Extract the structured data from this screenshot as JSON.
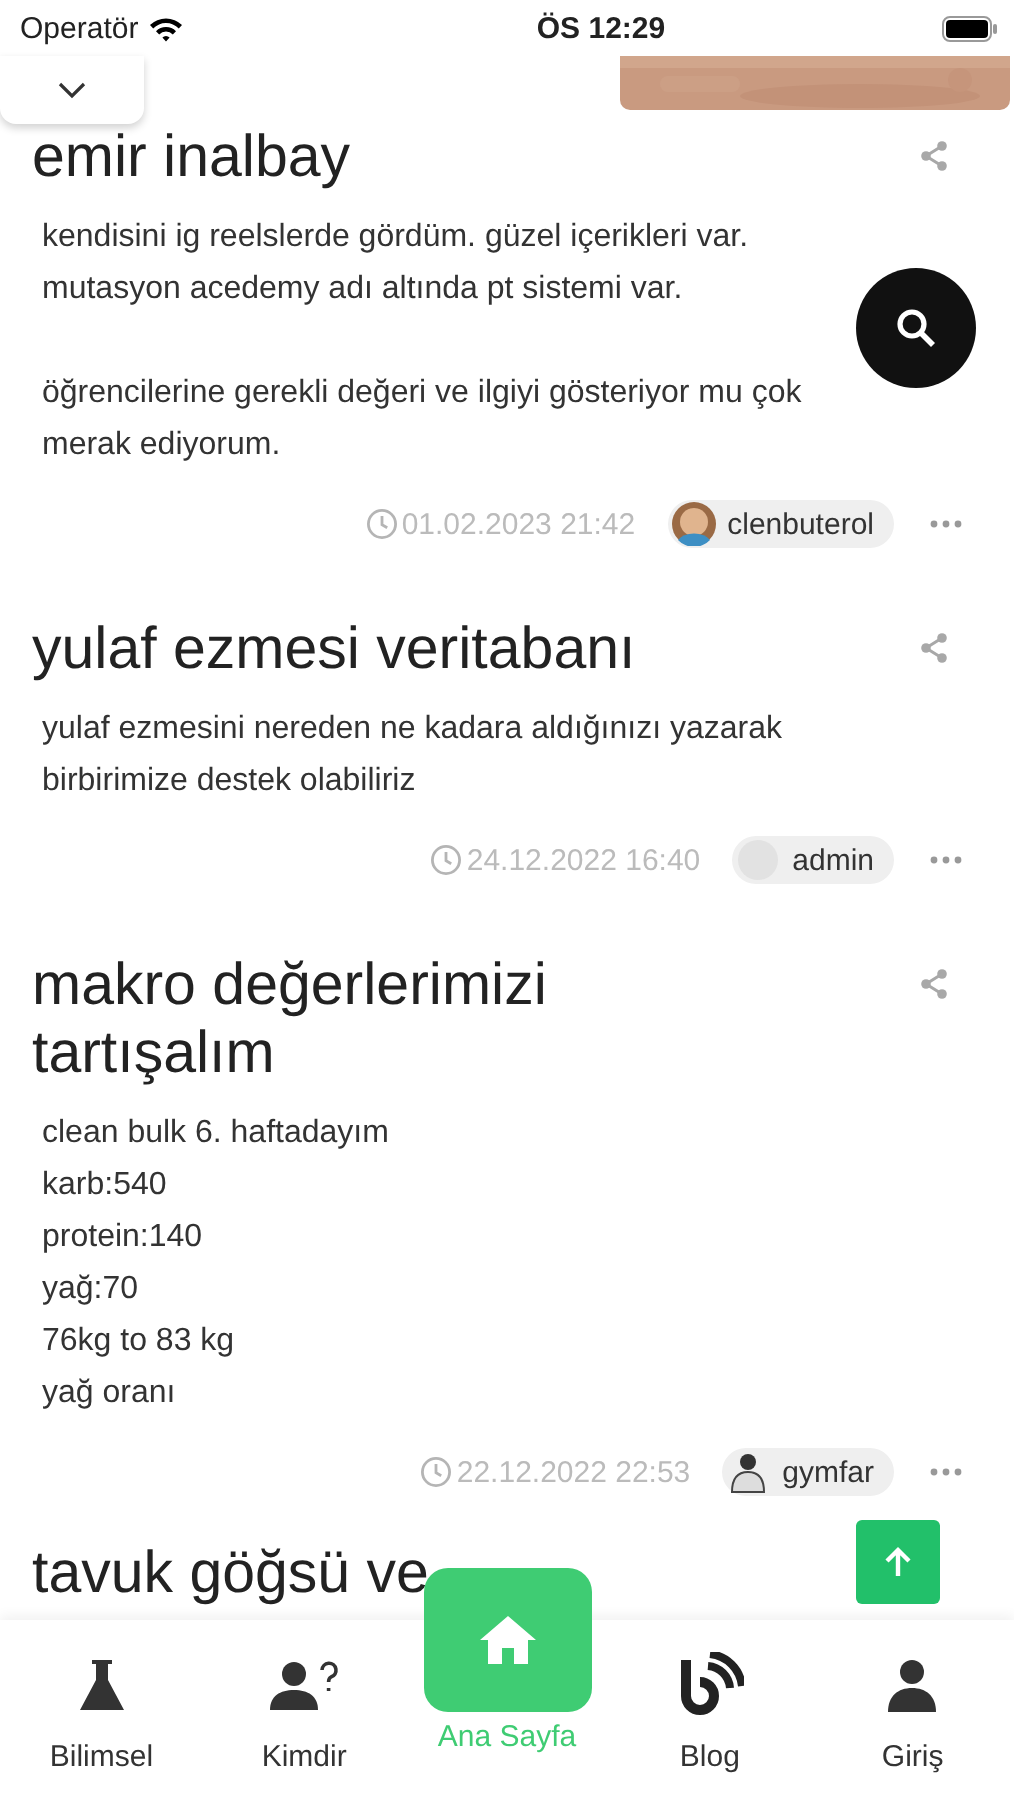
{
  "status_bar": {
    "carrier": "Operatör",
    "time": "ÖS 12:29"
  },
  "posts": [
    {
      "title": "emir inalbay",
      "body": [
        "kendisini ig reelslerde gördüm. güzel içerikleri var. mutasyon acedemy adı altında pt sistemi var.",
        "öğrencilerine gerekli değeri ve ilgiyi gösteriyor mu çok merak ediyorum."
      ],
      "date": "01.02.2023 21:42",
      "author": "clenbuterol"
    },
    {
      "title": "yulaf ezmesi veritabanı",
      "body": [
        "yulaf ezmesini nereden ne kadara aldığınızı yazarak birbirimize destek olabiliriz"
      ],
      "date": "24.12.2022 16:40",
      "author": "admin"
    },
    {
      "title": "makro değerlerimizi tartışalım",
      "body": [
        "clean bulk 6. haftadayım\nkarb:540\nprotein:140\nyağ:70\n76kg to 83 kg\nyağ oranı"
      ],
      "date": "22.12.2022 22:53",
      "author": "gymfar"
    },
    {
      "title": "tavuk göğsü ve"
    }
  ],
  "nav": [
    {
      "kind": "flask",
      "label": "Bilimsel",
      "selected": false
    },
    {
      "kind": "person-question",
      "label": "Kimdir",
      "selected": false
    },
    {
      "kind": "home",
      "label": "Ana Sayfa",
      "selected": true
    },
    {
      "kind": "blog",
      "label": "Blog",
      "selected": false
    },
    {
      "kind": "person",
      "label": "Giriş",
      "selected": false
    }
  ]
}
